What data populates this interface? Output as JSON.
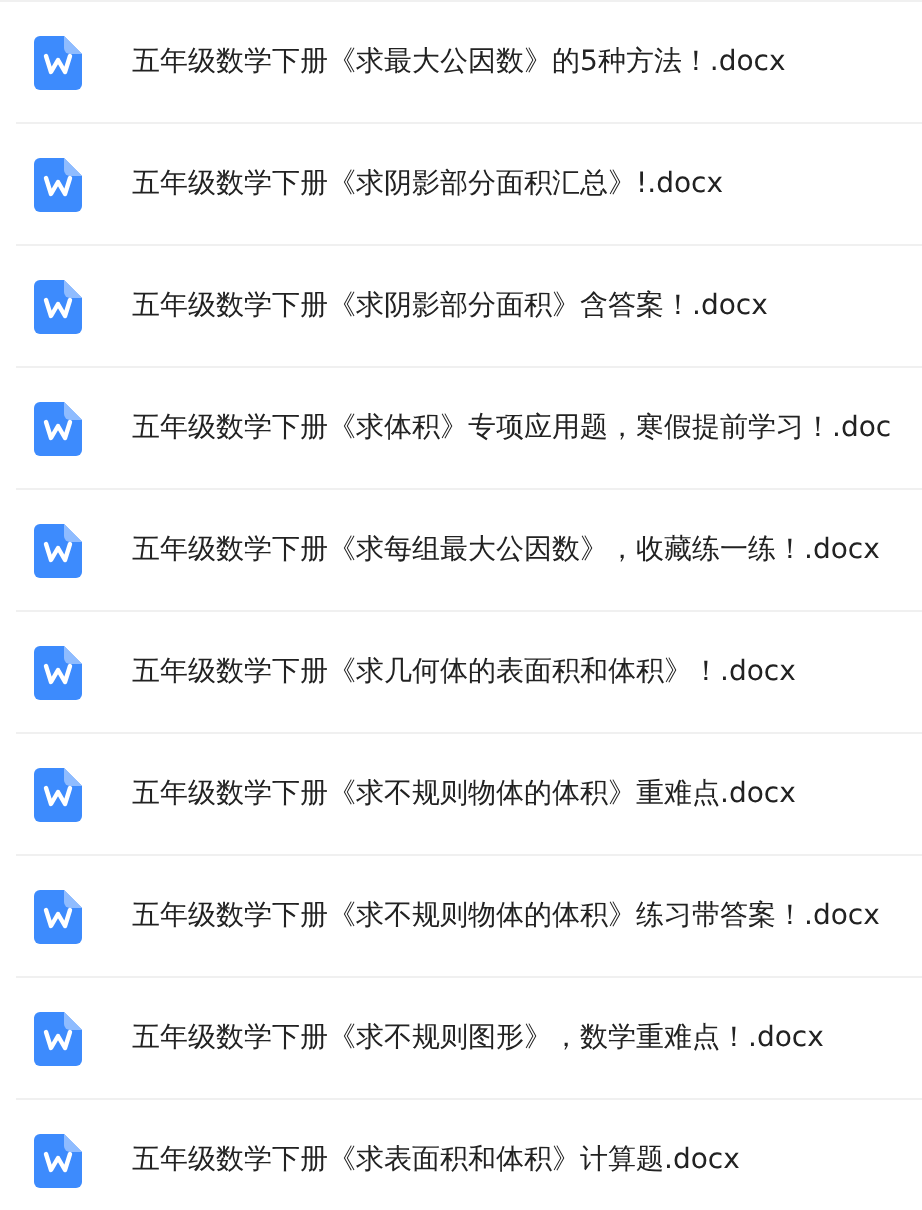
{
  "files": [
    {
      "name": "五年级数学下册《求最大公因数》的5种方法！.docx"
    },
    {
      "name": "五年级数学下册《求阴影部分面积汇总》!.docx"
    },
    {
      "name": "五年级数学下册《求阴影部分面积》含答案！.docx"
    },
    {
      "name": "五年级数学下册《求体积》专项应用题，寒假提前学习！.doc"
    },
    {
      "name": "五年级数学下册《求每组最大公因数》，收藏练一练！.docx"
    },
    {
      "name": "五年级数学下册《求几何体的表面积和体积》！.docx"
    },
    {
      "name": "五年级数学下册《求不规则物体的体积》重难点.docx"
    },
    {
      "name": "五年级数学下册《求不规则物体的体积》练习带答案！.docx"
    },
    {
      "name": "五年级数学下册《求不规则图形》，数学重难点！.docx"
    },
    {
      "name": "五年级数学下册《求表面积和体积》计算题.docx"
    }
  ]
}
